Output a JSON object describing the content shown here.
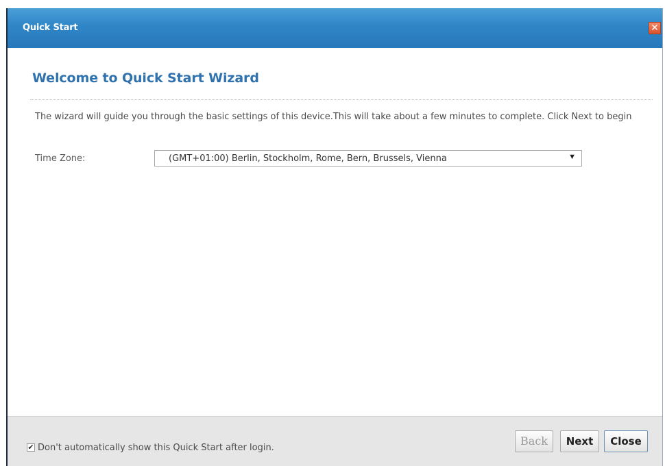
{
  "window": {
    "title": "Quick Start",
    "close_icon": "close-icon",
    "close_glyph": "✕"
  },
  "main": {
    "heading": "Welcome to Quick Start Wizard",
    "intro": "The wizard will guide you through the basic settings of this device.This will take about a few minutes to complete. Click Next to begin",
    "timezone": {
      "label": "Time Zone:",
      "value": "(GMT+01:00) Berlin, Stockholm, Rome, Bern, Brussels, Vienna",
      "arrow": "▼"
    }
  },
  "footer": {
    "checkbox_checked": true,
    "checkbox_mark": "✔",
    "checkbox_label": "Don't automatically show this Quick Start after login.",
    "buttons": {
      "back": "Back",
      "next": "Next",
      "close": "Close"
    }
  },
  "colors": {
    "title_bar": "#2f86c6",
    "heading": "#2f72ad",
    "close_button": "#d9532d"
  }
}
